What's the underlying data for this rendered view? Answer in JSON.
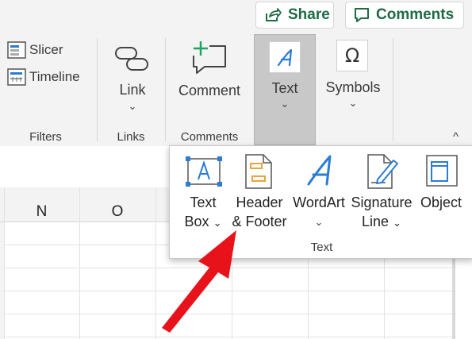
{
  "topbar": {
    "share_label": "Share",
    "comments_label": "Comments"
  },
  "ribbon": {
    "filters": {
      "slicer_label": "Slicer",
      "timeline_label": "Timeline",
      "group_label": "Filters"
    },
    "links": {
      "link_label": "Link",
      "group_label": "Links"
    },
    "comments": {
      "comment_label": "Comment",
      "group_label": "Comments"
    },
    "text": {
      "text_label": "Text"
    },
    "symbols": {
      "symbols_label": "Symbols"
    },
    "chevron": "⌄",
    "collapse": "^"
  },
  "grid": {
    "columns": [
      "N",
      "O"
    ]
  },
  "text_dropdown": {
    "text_box_line1": "Text",
    "text_box_line2": "Box",
    "header_footer_line1": "Header",
    "header_footer_line2": "& Footer",
    "wordart_label": "WordArt",
    "signature_line1": "Signature",
    "signature_line2": "Line",
    "object_label": "Object",
    "group_label": "Text"
  },
  "colors": {
    "accent_green": "#1f6b45",
    "icon_blue": "#2b7cd3",
    "arrow_red": "#e8131a"
  }
}
